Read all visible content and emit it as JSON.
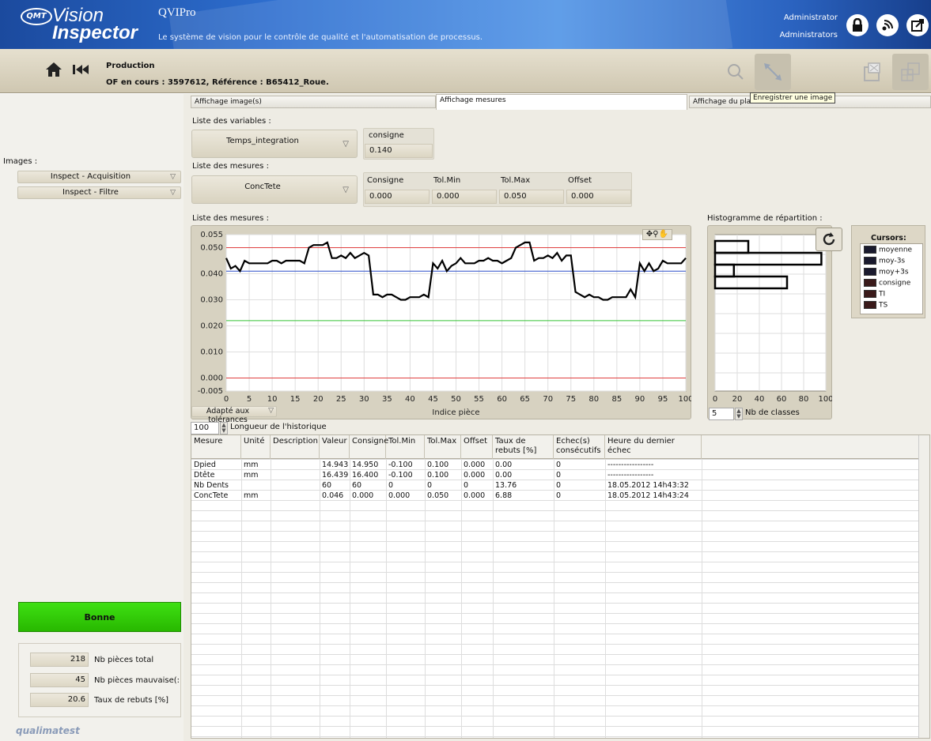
{
  "header": {
    "logo_badge": "QMT",
    "logo_line1": "Vision",
    "logo_line2": "Inspector",
    "app_name": "QVIPro",
    "subtitle": "Le système de vision pour le contrôle de qualité et l'automatisation de processus.",
    "user_name": "Administrator",
    "user_role": "Administrators"
  },
  "toolbar": {
    "title": "Production",
    "info": "OF en cours : 3597612, Référence : B65412_Roue.",
    "tooltip": "Enregistrer une image"
  },
  "left": {
    "images_label": "Images :",
    "image_items": [
      "Inspect - Acquisition",
      "Inspect - Filtre"
    ],
    "status": "Bonne",
    "counters": [
      {
        "value": "218",
        "label": "Nb pièces total"
      },
      {
        "value": "45",
        "label": "Nb pièces mauvaise(:"
      },
      {
        "value": "20.6",
        "label": "Taux de rebuts [%]"
      }
    ],
    "footer_logo": "qualimatest"
  },
  "tabs": [
    "Affichage image(s)",
    "Affichage mesures",
    "Affichage du plan"
  ],
  "variables": {
    "label": "Liste des variables :",
    "selected": "Temps_integration",
    "consigne_label": "consigne",
    "consigne_value": "0.140"
  },
  "measures": {
    "label": "Liste des mesures :",
    "selected": "ConcTete",
    "fields": [
      {
        "label": "Consigne",
        "value": "0.000"
      },
      {
        "label": "Tol.Min",
        "value": "0.000"
      },
      {
        "label": "Tol.Max",
        "value": "0.050"
      },
      {
        "label": "Offset",
        "value": "0.000"
      }
    ]
  },
  "chart": {
    "section_label": "Liste des mesures :",
    "scale_mode": "Adapté aux tolérances",
    "history_value": "100",
    "history_label": "Longueur de l'historique"
  },
  "chart_data": [
    {
      "type": "line",
      "title": "",
      "xlabel": "Indice pièce",
      "ylabel": "",
      "xlim": [
        0,
        100
      ],
      "ylim": [
        -0.005,
        0.055
      ],
      "x_ticks": [
        0,
        5,
        10,
        15,
        20,
        25,
        30,
        35,
        40,
        45,
        50,
        55,
        60,
        65,
        70,
        75,
        80,
        85,
        90,
        95,
        100
      ],
      "y_ticks": [
        "0.055",
        "0.050",
        "0.040",
        "0.030",
        "0.020",
        "0.010",
        "0.000",
        "-0.005"
      ],
      "grid": true,
      "series": [
        {
          "color": "#000000",
          "values": [
            0.046,
            0.042,
            0.043,
            0.041,
            0.045,
            0.044,
            0.044,
            0.044,
            0.044,
            0.044,
            0.045,
            0.045,
            0.044,
            0.045,
            0.045,
            0.045,
            0.045,
            0.044,
            0.05,
            0.051,
            0.051,
            0.051,
            0.052,
            0.046,
            0.046,
            0.047,
            0.046,
            0.048,
            0.046,
            0.047,
            0.048,
            0.047,
            0.032,
            0.032,
            0.031,
            0.032,
            0.032,
            0.031,
            0.03,
            0.03,
            0.031,
            0.031,
            0.031,
            0.032,
            0.031,
            0.044,
            0.042,
            0.045,
            0.041,
            0.043,
            0.044,
            0.046,
            0.044,
            0.044,
            0.044,
            0.045,
            0.045,
            0.046,
            0.045,
            0.045,
            0.044,
            0.045,
            0.046,
            0.05,
            0.051,
            0.052,
            0.052,
            0.045,
            0.046,
            0.046,
            0.047,
            0.046,
            0.048,
            0.045,
            0.047,
            0.047,
            0.033,
            0.032,
            0.031,
            0.032,
            0.031,
            0.031,
            0.03,
            0.03,
            0.031,
            0.031,
            0.031,
            0.031,
            0.034,
            0.031,
            0.044,
            0.041,
            0.044,
            0.041,
            0.042,
            0.045,
            0.044,
            0.044,
            0.044,
            0.044,
            0.046
          ]
        },
        {
          "color": "#e04040",
          "values": [
            0.05,
            0.05
          ]
        },
        {
          "color": "#2a4fc8",
          "values": [
            0.041,
            0.041
          ]
        },
        {
          "color": "#33c233",
          "values": [
            0.022,
            0.022
          ]
        },
        {
          "color": "#e04040",
          "values": [
            0.0,
            0.0
          ]
        }
      ]
    },
    {
      "type": "bar",
      "title": "Histogramme de répartition :",
      "orientation": "horizontal",
      "xlim": [
        0,
        100
      ],
      "x_ticks": [
        0,
        20,
        40,
        60,
        80,
        100
      ],
      "values": [
        30,
        96,
        17,
        65,
        0
      ],
      "bins_value": "5",
      "bins_label": "Nb de classes"
    }
  ],
  "cursors": {
    "title": "Cursors:",
    "items": [
      "moyenne",
      "moy-3s",
      "moy+3s",
      "consigne",
      "TI",
      "TS"
    ]
  },
  "table": {
    "headers": [
      "Mesure",
      "Unité",
      "Description",
      "Valeur",
      "Consigne",
      "Tol.Min",
      "Tol.Max",
      "Offset",
      "Taux de rebuts [%]",
      "Echec(s) consécutifs",
      "Heure du dernier échec"
    ],
    "rows": [
      [
        "Dpied",
        "mm",
        "",
        "14.943",
        "14.950",
        "-0.100",
        "0.100",
        "0.000",
        "0.00",
        "0",
        "-----------------"
      ],
      [
        "Dtête",
        "mm",
        "",
        "16.439",
        "16.400",
        "-0.100",
        "0.100",
        "0.000",
        "0.00",
        "0",
        "-----------------"
      ],
      [
        "Nb Dents",
        "",
        "",
        "60",
        "60",
        "0",
        "0",
        "0",
        "13.76",
        "0",
        "18.05.2012  14h43:32"
      ],
      [
        "ConcTete",
        "mm",
        "",
        "0.046",
        "0.000",
        "0.000",
        "0.050",
        "0.000",
        "6.88",
        "0",
        "18.05.2012  14h43:24"
      ]
    ]
  }
}
